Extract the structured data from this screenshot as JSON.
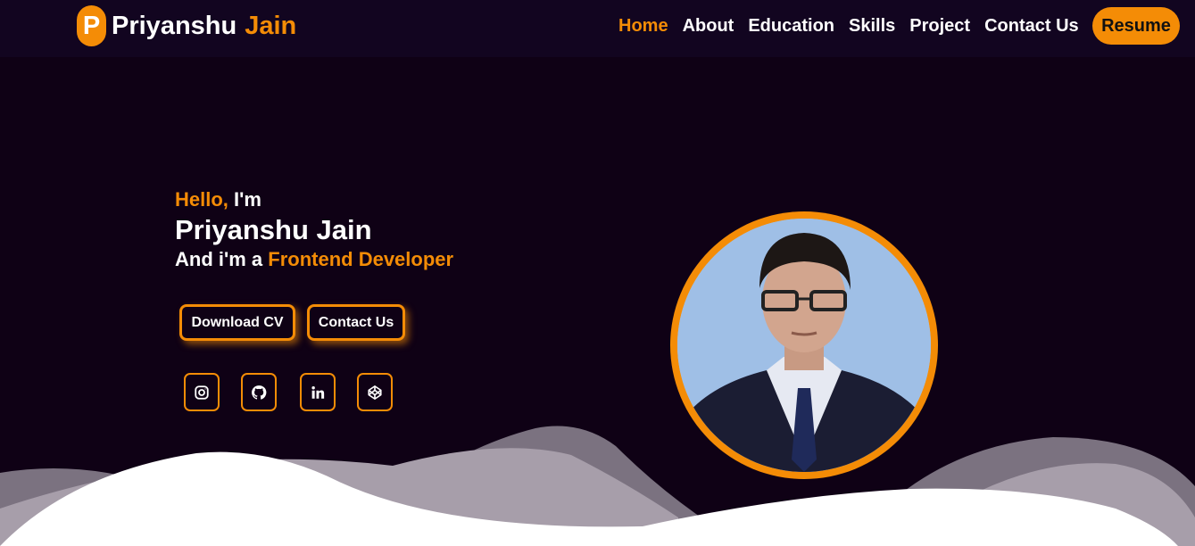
{
  "brand": {
    "initial": "P",
    "first_name": "Priyanshu",
    "last_name": "Jain"
  },
  "nav": {
    "items": [
      {
        "label": "Home",
        "active": true
      },
      {
        "label": "About",
        "active": false
      },
      {
        "label": "Education",
        "active": false
      },
      {
        "label": "Skills",
        "active": false
      },
      {
        "label": "Project",
        "active": false
      },
      {
        "label": "Contact Us",
        "active": false
      }
    ],
    "resume_label": "Resume"
  },
  "hero": {
    "greeting_accent": "Hello,",
    "greeting_rest": "I'm",
    "name": "Priyanshu Jain",
    "role_prefix": "And i'm a",
    "role": "Frontend Developer",
    "download_cv_label": "Download CV",
    "contact_label": "Contact Us"
  },
  "social": [
    {
      "icon": "instagram-icon"
    },
    {
      "icon": "github-icon"
    },
    {
      "icon": "linkedin-icon"
    },
    {
      "icon": "codepen-icon"
    }
  ],
  "colors": {
    "accent": "#f48c06",
    "background": "#0f0115",
    "navbar": "#120520"
  }
}
